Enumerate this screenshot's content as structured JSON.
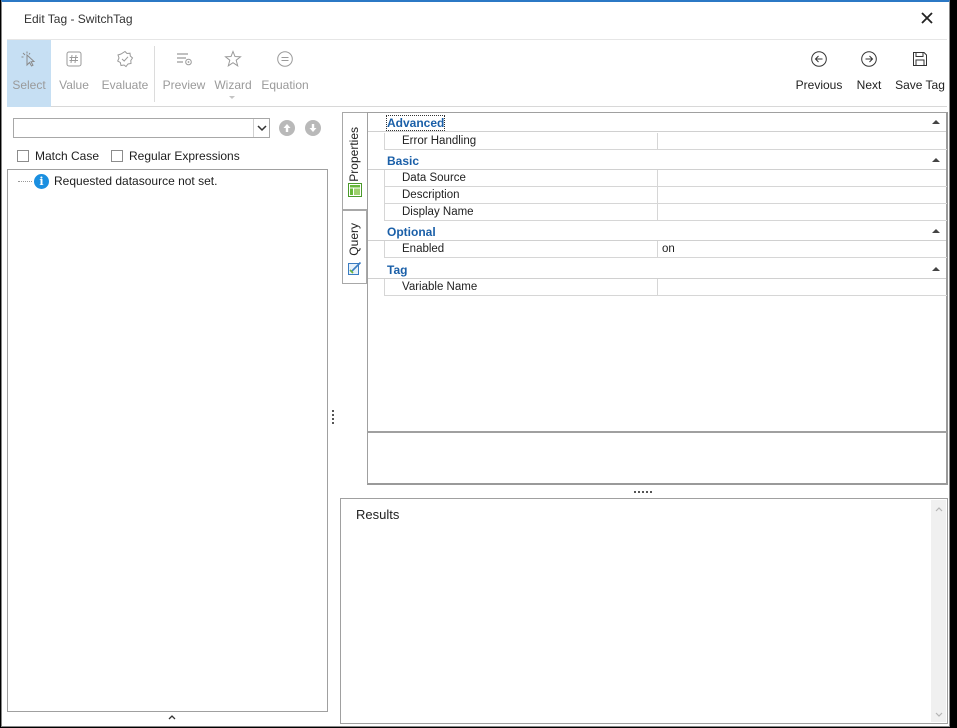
{
  "window": {
    "title": "Edit Tag - SwitchTag",
    "accent_color": "#2b78c5"
  },
  "ribbon": {
    "left_buttons": [
      {
        "label": "Select",
        "icon": "cursor-icon",
        "state": "active"
      },
      {
        "label": "Value",
        "icon": "hash-icon",
        "state": "disabled"
      },
      {
        "label": "Evaluate",
        "icon": "check-badge-icon",
        "state": "disabled"
      },
      {
        "label": "Preview",
        "icon": "preview-list-icon",
        "state": "disabled"
      },
      {
        "label": "Wizard",
        "icon": "wizard-star-icon",
        "state": "disabled"
      },
      {
        "label": "Equation",
        "icon": "equals-circle-icon",
        "state": "disabled"
      }
    ],
    "right_buttons": [
      {
        "label": "Previous",
        "icon": "arrow-left-circle-icon"
      },
      {
        "label": "Next",
        "icon": "arrow-right-circle-icon"
      },
      {
        "label": "Save Tag",
        "icon": "floppy-disk-icon"
      }
    ]
  },
  "search": {
    "value": "",
    "match_case_label": "Match Case",
    "match_case_checked": false,
    "regex_label": "Regular Expressions",
    "regex_checked": false
  },
  "tree": {
    "message": "Requested datasource not set."
  },
  "side_tabs": [
    "Properties",
    "Query"
  ],
  "property_grid": {
    "categories": [
      {
        "name": "Advanced",
        "rows": [
          {
            "name": "Error Handling",
            "value": ""
          }
        ]
      },
      {
        "name": "Basic",
        "rows": [
          {
            "name": "Data Source",
            "value": ""
          },
          {
            "name": "Description",
            "value": ""
          },
          {
            "name": "Display Name",
            "value": ""
          }
        ]
      },
      {
        "name": "Optional",
        "rows": [
          {
            "name": "Enabled",
            "value": "on"
          }
        ]
      },
      {
        "name": "Tag",
        "rows": [
          {
            "name": "Variable Name",
            "value": ""
          }
        ]
      }
    ]
  },
  "results": {
    "title": "Results"
  }
}
